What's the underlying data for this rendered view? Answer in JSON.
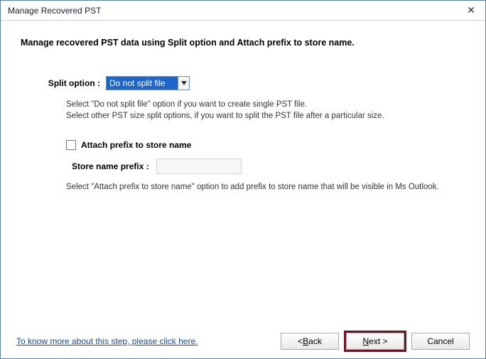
{
  "window": {
    "title": "Manage Recovered PST",
    "close_glyph": "✕"
  },
  "heading": "Manage recovered PST data using Split option and Attach prefix to store name.",
  "split": {
    "label": "Split option :",
    "selected": "Do not split file",
    "hint1": "Select  \"Do not split file\" option if you want to create single PST file.",
    "hint2": "Select other PST size split options, if you want to split the PST file after a particular size."
  },
  "attach": {
    "checkbox_label": "Attach prefix to store name",
    "checked": false,
    "prefix_label": "Store name prefix :",
    "prefix_value": "",
    "hint": "Select \"Attach prefix to store name\" option to add prefix to store name that will be visible in Ms Outlook."
  },
  "footer": {
    "help_link": "To know more about this step, please click here.",
    "back_prefix": "< ",
    "back_m": "B",
    "back_rest": "ack",
    "next_m": "N",
    "next_rest": "ext >",
    "cancel": "Cancel"
  }
}
